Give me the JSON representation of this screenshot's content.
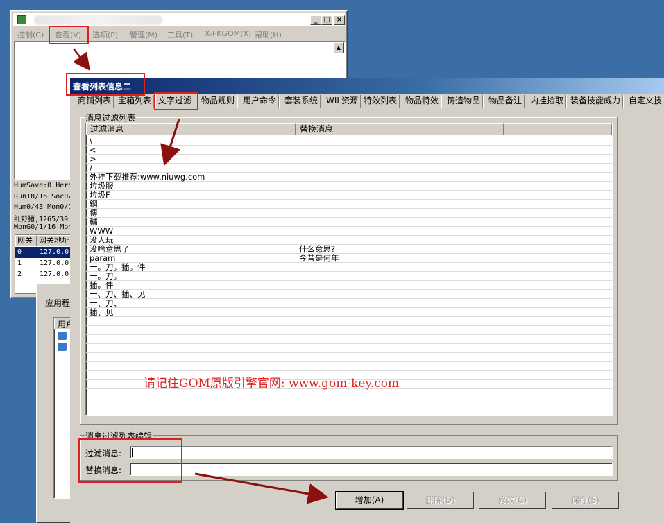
{
  "bg_window": {
    "menu": [
      "控制(C)",
      "查看(V)",
      "选项(P)",
      "管理(M)",
      "工具(T)",
      "X-FKGOM(X)",
      "帮助(H)"
    ],
    "title_buttons": [
      "_",
      "□",
      "×"
    ],
    "status_lines": [
      "HumSave:0 Hero",
      "Run18/16 Soc0/",
      "Hum0/43 Mon0/1",
      "红野猪,1265/39",
      "MonG0/1/16 Mon"
    ],
    "gate_table": {
      "headers": [
        "网关",
        "网关地址"
      ],
      "rows": [
        [
          "0",
          "127.0.0."
        ],
        [
          "1",
          "127.0.0."
        ],
        [
          "2",
          "127.0.0."
        ]
      ]
    },
    "mid_window": {
      "label": "应用程",
      "col_header": "用户"
    }
  },
  "main_window": {
    "title": "查看列表信息二",
    "tabs": [
      "商铺列表",
      "宝箱列表",
      "文字过滤",
      "物品规则",
      "用户命令",
      "套装系统",
      "WIL资源",
      "特效列表",
      "物品特效",
      "铸造物品",
      "物品备注",
      "内挂捡取",
      "装备技能威力",
      "自定义技"
    ],
    "active_tab": "文字过滤",
    "filter_group_label": "消息过滤列表",
    "list": {
      "headers": [
        "过滤消息",
        "替换消息",
        ""
      ],
      "rows": [
        [
          "\\",
          ""
        ],
        [
          "<",
          ""
        ],
        [
          ">",
          ""
        ],
        [
          "/",
          ""
        ],
        [
          "外挂下载推荐:www.niuwg.com",
          ""
        ],
        [
          "垃圾服",
          ""
        ],
        [
          "垃圾F",
          ""
        ],
        [
          "鋼",
          ""
        ],
        [
          "傳",
          ""
        ],
        [
          "輔",
          ""
        ],
        [
          "WWW",
          ""
        ],
        [
          "没人玩",
          ""
        ],
        [
          "没啥意思了",
          "什么意思?"
        ],
        [
          "param",
          "今昔是何年"
        ],
        [
          "一。刀。插。件",
          ""
        ],
        [
          "一。刀。",
          ""
        ],
        [
          "插。件",
          ""
        ],
        [
          "一、刀、插、见",
          ""
        ],
        [
          "一、刀、",
          ""
        ],
        [
          "插、见",
          ""
        ]
      ]
    },
    "edit_group_label": "消息过滤列表编辑",
    "filter_label": "过滤消息:",
    "replace_label": "替换消息:",
    "filter_value": "",
    "replace_value": "",
    "buttons": {
      "add": "增加(A)",
      "delete": "删除(D)",
      "modify": "修改(C)",
      "save": "保存(S)"
    }
  },
  "watermark": "请记住GOM原版引擎官网: www.gom-key.com",
  "colors": {
    "highlight": "#e02020",
    "arrow": "#8b1010",
    "desktop": "#3a6ea5",
    "title_bar": "#0a246a"
  }
}
